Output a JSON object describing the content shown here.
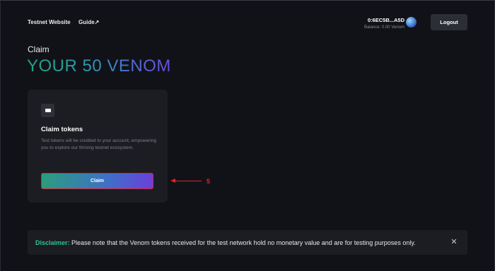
{
  "header": {
    "nav": {
      "testnet_website": "Testnet Website",
      "guide": "Guide",
      "guide_icon": "external-link-icon"
    },
    "wallet": {
      "address": "0:6EC5B...A5D",
      "balance": "Balance: 0.00 Venom"
    },
    "logout_label": "Logout"
  },
  "page": {
    "label": "Claim",
    "hero_title": "YOUR 50 VENOM"
  },
  "card": {
    "icon": "wallet-icon",
    "title": "Claim tokens",
    "description": "Test tokens will be credited to your account, empowering you to explore our thriving testnet ecosystem.",
    "button_label": "Claim"
  },
  "annotation": {
    "number": "5",
    "color": "#e0242a"
  },
  "disclaimer": {
    "label": "Disclaimer:",
    "text": " Please note that the Venom tokens received for the test network hold no monetary value and are for testing purposes only.",
    "close_icon": "close-icon"
  },
  "colors": {
    "background": "#111217",
    "card": "#1c1d23",
    "accent_green": "#2ec295",
    "accent_purple": "#6a40db"
  }
}
